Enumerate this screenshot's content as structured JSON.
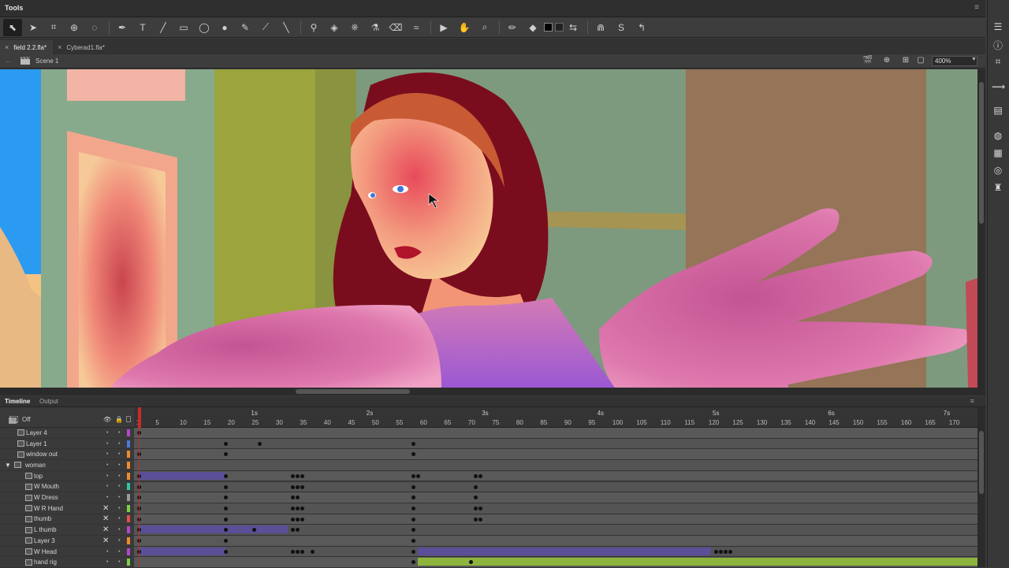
{
  "panel": {
    "title": "Tools",
    "menu_glyph": "≡"
  },
  "toolbar": {
    "tools": [
      {
        "name": "selection-tool-icon",
        "glyph": "⬉",
        "active": true
      },
      {
        "name": "subselection-tool-icon",
        "glyph": "➤",
        "active": false
      },
      {
        "name": "free-transform-tool-icon",
        "glyph": "⌗",
        "active": false
      },
      {
        "name": "3d-rotation-tool-icon",
        "glyph": "⊕",
        "active": false
      },
      {
        "name": "lasso-tool-icon",
        "glyph": "◌",
        "active": false
      },
      {
        "name": "pen-tool-icon",
        "glyph": "✒",
        "active": false
      },
      {
        "name": "text-tool-icon",
        "glyph": "T",
        "active": false
      },
      {
        "name": "line-tool-icon",
        "glyph": "╱",
        "active": false
      },
      {
        "name": "rectangle-tool-icon",
        "glyph": "▭",
        "active": false
      },
      {
        "name": "oval-tool-icon",
        "glyph": "◯",
        "active": false
      },
      {
        "name": "polystar-tool-icon",
        "glyph": "●",
        "active": false
      },
      {
        "name": "pencil-tool-icon",
        "glyph": "✎",
        "active": false
      },
      {
        "name": "paint-brush-tool-icon",
        "glyph": "⟋",
        "active": false
      },
      {
        "name": "brush-tool-icon",
        "glyph": "╲",
        "active": false
      },
      {
        "name": "bone-tool-icon",
        "glyph": "⚲",
        "active": false
      },
      {
        "name": "paint-bucket-tool-icon",
        "glyph": "◈",
        "active": false
      },
      {
        "name": "ink-bottle-tool-icon",
        "glyph": "⎈",
        "active": false
      },
      {
        "name": "eyedropper-tool-icon",
        "glyph": "⚗",
        "active": false
      },
      {
        "name": "eraser-tool-icon",
        "glyph": "⌫",
        "active": false
      },
      {
        "name": "width-tool-icon",
        "glyph": "≈",
        "active": false
      },
      {
        "name": "camera-tool-icon",
        "glyph": "▶",
        "active": false
      },
      {
        "name": "hand-tool-icon",
        "glyph": "✋",
        "active": false
      },
      {
        "name": "zoom-tool-icon",
        "glyph": "⌕",
        "active": false
      },
      {
        "name": "stroke-color-icon",
        "glyph": "✏",
        "active": false
      },
      {
        "name": "fill-color-icon",
        "glyph": "◆",
        "active": false
      },
      {
        "name": "swap-colors-icon",
        "glyph": "⇆",
        "active": false
      },
      {
        "name": "snap-to-objects-icon",
        "glyph": "⋒",
        "active": false
      },
      {
        "name": "smooth-icon",
        "glyph": "S",
        "active": false
      },
      {
        "name": "straighten-icon",
        "glyph": "↰",
        "active": false
      }
    ]
  },
  "doc_tabs": [
    {
      "label": "field 2.2.fla*",
      "close": "×",
      "active": true
    },
    {
      "label": "Cyberad1.fla*",
      "close": "×",
      "active": false
    }
  ],
  "scene": {
    "back_glyph": "←",
    "name": "Scene 1",
    "zoom": "400%",
    "zoom_arrow": "▼"
  },
  "timeline": {
    "tab_timeline": "Timeline",
    "tab_output": "Output",
    "menu_glyph": "≡",
    "header_off": "Off",
    "seconds": [
      {
        "label": "1s",
        "frame": 25
      },
      {
        "label": "2s",
        "frame": 49
      },
      {
        "label": "3s",
        "frame": 73
      },
      {
        "label": "4s",
        "frame": 97
      },
      {
        "label": "5s",
        "frame": 121
      },
      {
        "label": "6s",
        "frame": 145
      },
      {
        "label": "7s",
        "frame": 169
      }
    ],
    "frame_numbers": [
      "1",
      "5",
      "10",
      "15",
      "20",
      "25",
      "30",
      "35",
      "40",
      "45",
      "50",
      "55",
      "60",
      "65",
      "70",
      "75",
      "80",
      "85",
      "90",
      "95",
      "100",
      "105",
      "110",
      "115",
      "120",
      "125",
      "130",
      "135",
      "140",
      "145",
      "150",
      "155",
      "160",
      "165",
      "170"
    ],
    "layers": [
      {
        "name": "Layer 4",
        "indent": 0,
        "chip": "#b347c9",
        "x_mark": ""
      },
      {
        "name": "Layer 1",
        "indent": 0,
        "chip": "#4a7bd8",
        "x_mark": ""
      },
      {
        "name": "window out",
        "indent": 0,
        "chip": "#f08b2d",
        "x_mark": ""
      },
      {
        "name": "woman",
        "indent": 0,
        "chip": "#f08b2d",
        "x_mark": "",
        "folder": true
      },
      {
        "name": "top",
        "indent": 1,
        "chip": "#f08b2d",
        "x_mark": ""
      },
      {
        "name": "W Mouth",
        "indent": 1,
        "chip": "#2fc7a6",
        "x_mark": ""
      },
      {
        "name": "W Dress",
        "indent": 1,
        "chip": "#9a9a9a",
        "x_mark": ""
      },
      {
        "name": "W R Hand",
        "indent": 1,
        "chip": "#7ad347",
        "x_mark": "✕"
      },
      {
        "name": "thumb",
        "indent": 1,
        "chip": "#e84d4d",
        "x_mark": "✕"
      },
      {
        "name": "L thumb",
        "indent": 1,
        "chip": "#b347c9",
        "x_mark": "✕"
      },
      {
        "name": "Layer 3",
        "indent": 1,
        "chip": "#f08b2d",
        "x_mark": "✕"
      },
      {
        "name": "W Head",
        "indent": 1,
        "chip": "#b347c9",
        "x_mark": ""
      },
      {
        "name": "hand rig",
        "indent": 1,
        "chip": "#7ad347",
        "x_mark": ""
      }
    ]
  },
  "right_panel": {
    "icons": [
      {
        "name": "properties-icon",
        "glyph": "☰"
      },
      {
        "name": "info-icon",
        "glyph": "ⓘ"
      },
      {
        "name": "align-icon",
        "glyph": "⌗"
      },
      {
        "name": "motion-editor-icon",
        "glyph": "⟿"
      },
      {
        "name": "library-icon",
        "glyph": "▤"
      },
      {
        "name": "color-icon",
        "glyph": "◍"
      },
      {
        "name": "swatches-icon",
        "glyph": "▦"
      },
      {
        "name": "cc-libraries-icon",
        "glyph": "◎"
      },
      {
        "name": "components-icon",
        "glyph": "♜"
      }
    ]
  },
  "colors": {
    "playhead": "#c92a2a",
    "tween": "#5b4f98",
    "shape_tween": "#8db53e",
    "stage_bg": "#7d9a7e"
  }
}
